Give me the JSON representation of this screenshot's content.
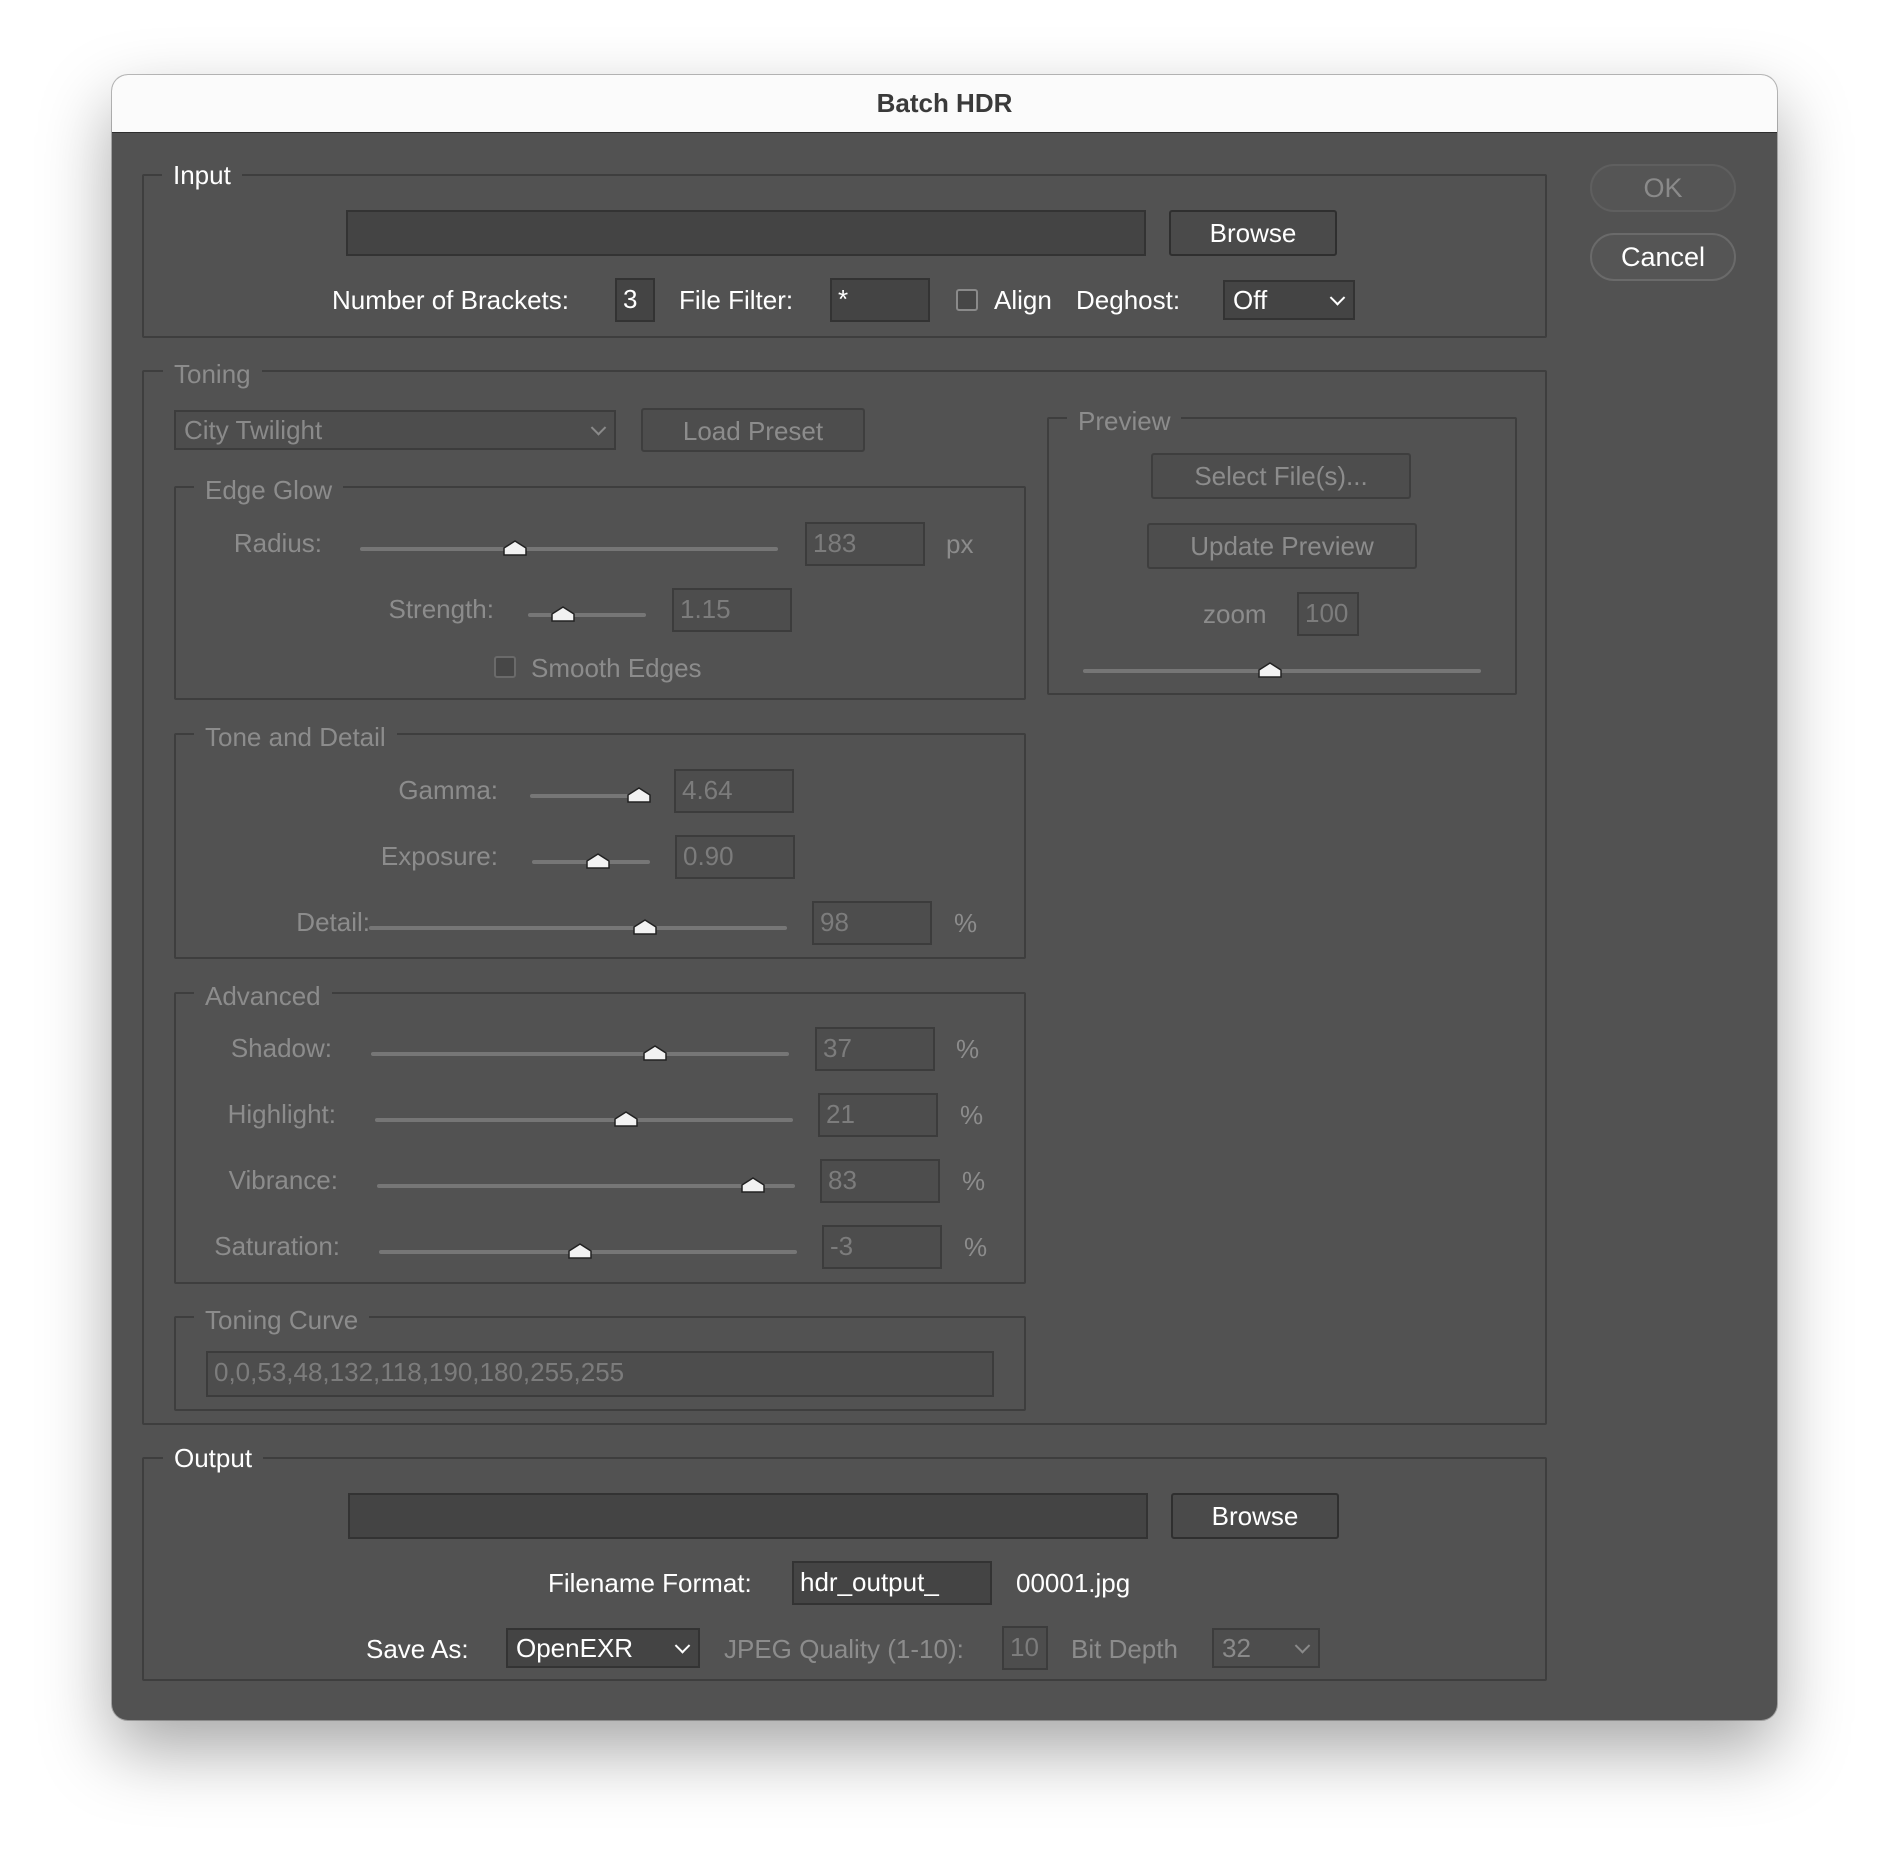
{
  "window": {
    "title": "Batch HDR"
  },
  "side_buttons": {
    "ok": "OK",
    "cancel": "Cancel"
  },
  "input": {
    "legend": "Input",
    "path": "",
    "browse": "Browse",
    "brackets_label": "Number of Brackets:",
    "brackets_value": "3",
    "filter_label": "File Filter:",
    "filter_value": "*",
    "align_label": "Align",
    "align_checked": false,
    "deghost_label": "Deghost:",
    "deghost_value": "Off"
  },
  "toning": {
    "legend": "Toning",
    "preset_value": "City Twilight",
    "load_preset": "Load Preset",
    "edge_glow": {
      "legend": "Edge Glow",
      "radius_label": "Radius:",
      "radius_value": "183",
      "radius_unit": "px",
      "radius_pos": 0.37,
      "strength_label": "Strength:",
      "strength_value": "1.15",
      "strength_pos": 0.3,
      "smooth_label": "Smooth Edges",
      "smooth_checked": false
    },
    "tone_detail": {
      "legend": "Tone and Detail",
      "gamma_label": "Gamma:",
      "gamma_value": "4.64",
      "gamma_pos": 0.92,
      "exposure_label": "Exposure:",
      "exposure_value": "0.90",
      "exposure_pos": 0.56,
      "detail_label": "Detail:",
      "detail_value": "98",
      "detail_unit": "%",
      "detail_pos": 0.66
    },
    "advanced": {
      "legend": "Advanced",
      "shadow_label": "Shadow:",
      "shadow_value": "37",
      "shadow_pos": 0.68,
      "highlight_label": "Highlight:",
      "highlight_value": "21",
      "highlight_pos": 0.6,
      "vibrance_label": "Vibrance:",
      "vibrance_value": "83",
      "vibrance_pos": 0.9,
      "saturation_label": "Saturation:",
      "saturation_value": "-3",
      "saturation_pos": 0.48,
      "unit": "%"
    },
    "curve": {
      "legend": "Toning Curve",
      "value": "0,0,53,48,132,118,190,180,255,255"
    },
    "preview": {
      "legend": "Preview",
      "select_files": "Select File(s)...",
      "update": "Update Preview",
      "zoom_label": "zoom",
      "zoom_value": "100",
      "zoom_pos": 0.47
    }
  },
  "output": {
    "legend": "Output",
    "path": "",
    "browse": "Browse",
    "filename_label": "Filename Format:",
    "filename_value": "hdr_output_",
    "filename_suffix": "00001.jpg",
    "save_as_label": "Save As:",
    "save_as_value": "OpenEXR",
    "jpeg_label": "JPEG Quality (1-10):",
    "jpeg_value": "10",
    "bit_depth_label": "Bit Depth",
    "bit_depth_value": "32"
  }
}
